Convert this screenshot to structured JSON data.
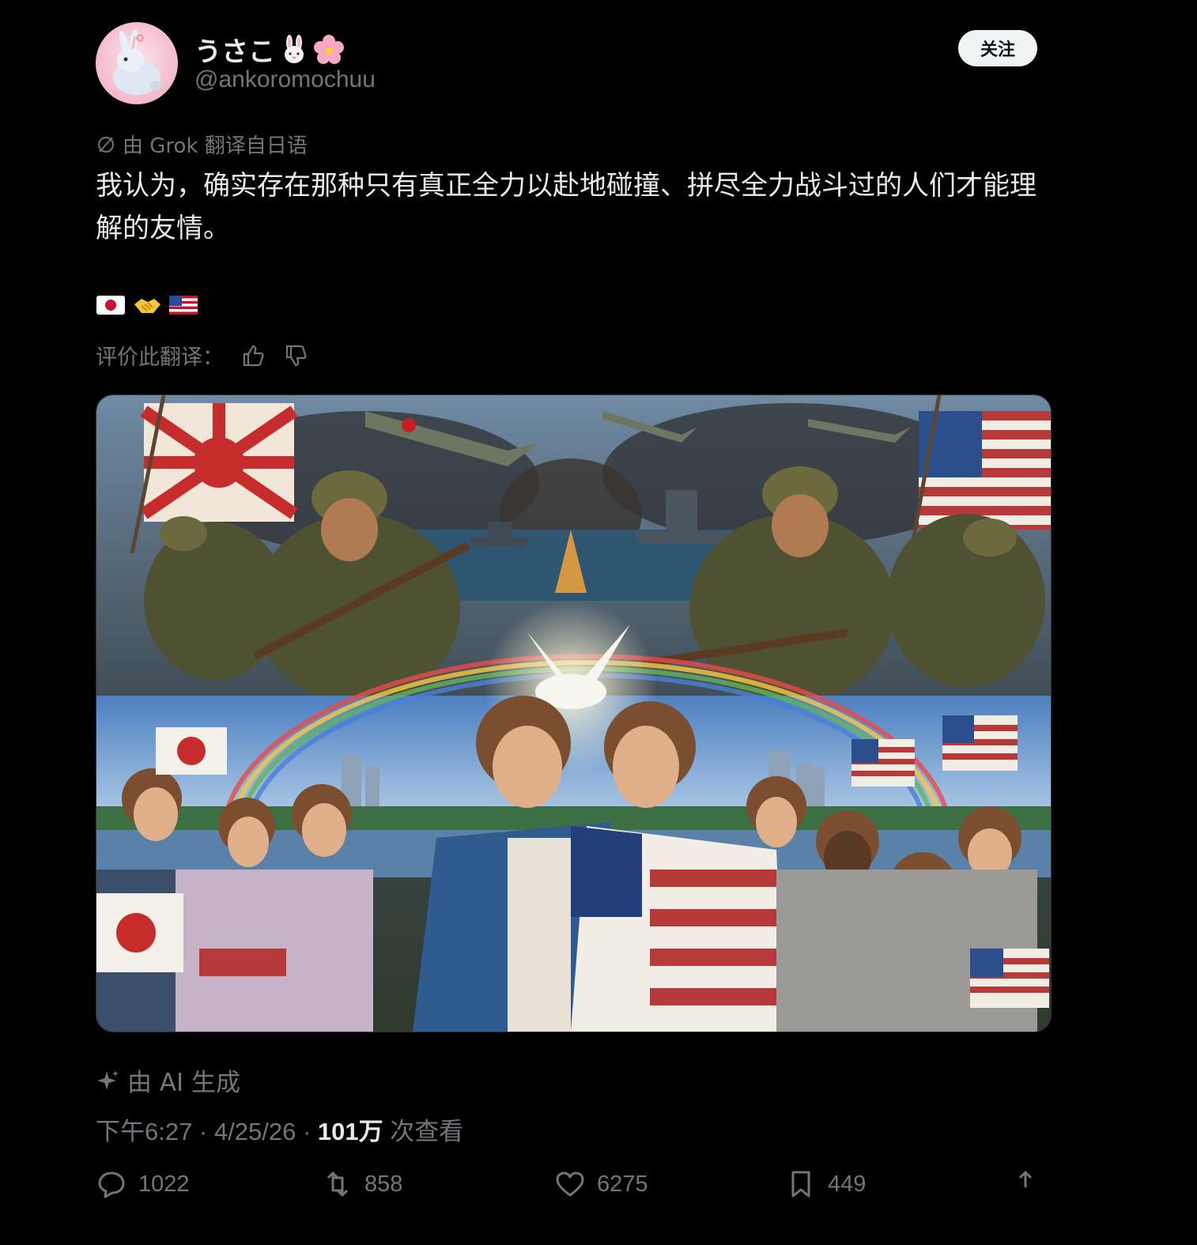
{
  "author": {
    "display_name": "うさこ",
    "name_emojis": [
      "rabbit-face",
      "cherry-blossom"
    ],
    "handle": "@ankoromochuu",
    "follow_label": "关注"
  },
  "tweet": {
    "translation_note": "由 Grok 翻译自日语",
    "text": "我认为，确实存在那种只有真正全力以赴地碰撞、拼尽全力战斗过的人们才能理解的友情。",
    "emojis": [
      "flag-japan",
      "handshake",
      "flag-usa"
    ],
    "rate_translation_label": "评价此翻译："
  },
  "media": {
    "description_icons": [
      "rising-sun-flag",
      "us-flag",
      "dove",
      "rainbow",
      "japan-flag"
    ]
  },
  "ai_generated_label": "由 AI 生成",
  "meta": {
    "time": "下午6:27",
    "date": "4/25/26",
    "views": "101万",
    "views_label": "次查看"
  },
  "actions": {
    "replies": "1022",
    "reposts": "858",
    "likes": "6275",
    "bookmarks": "449"
  },
  "colors": {
    "background": "#000000",
    "text": "#e7e9ea",
    "muted": "#71767b",
    "follow_bg": "#eff3f4"
  }
}
